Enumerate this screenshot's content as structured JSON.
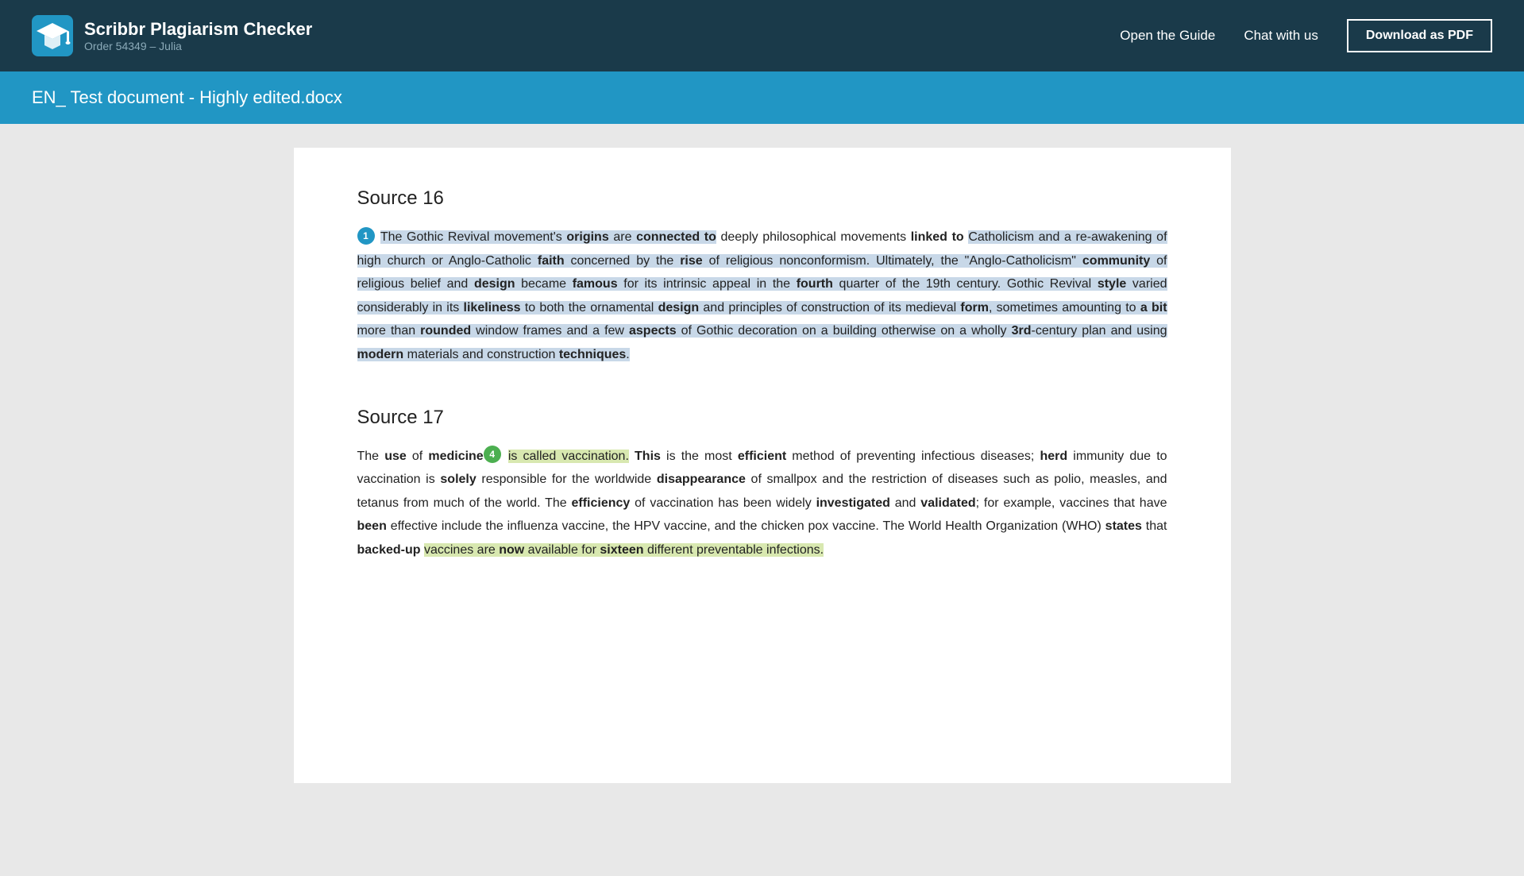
{
  "header": {
    "logo_title": "Scribbr Plagiarism Checker",
    "logo_subtitle": "Order 54349 – Julia",
    "nav": {
      "guide_label": "Open the Guide",
      "chat_label": "Chat with us",
      "download_label": "Download as PDF"
    }
  },
  "file_banner": {
    "file_name": "EN_ Test document - Highly edited.docx"
  },
  "source16": {
    "heading": "Source 16",
    "badge_number": "1",
    "badge_color": "blue",
    "paragraph": "source16_paragraph"
  },
  "source17": {
    "heading": "Source 17",
    "badge_number": "4",
    "badge_color": "green",
    "paragraph": "source17_paragraph"
  }
}
